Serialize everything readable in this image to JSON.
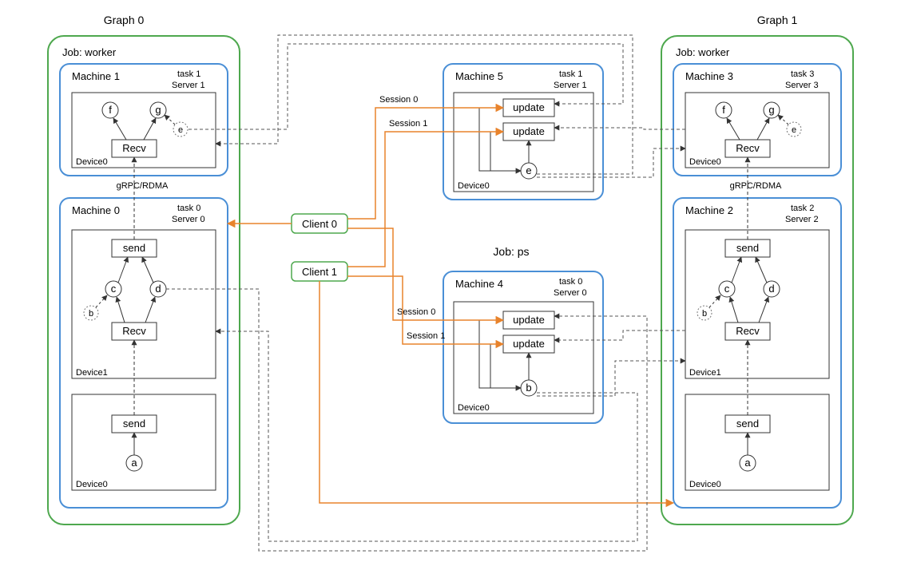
{
  "graphs": {
    "left": {
      "title": "Graph 0"
    },
    "right": {
      "title": "Graph 1"
    }
  },
  "job_worker_label": "Job: worker",
  "job_ps_label": "Job: ps",
  "left_graph": {
    "machine1": {
      "title": "Machine 1",
      "task": "task 1",
      "server": "Server 1",
      "device": "Device0",
      "recv": "Recv",
      "f": "f",
      "g": "g",
      "e": "e"
    },
    "transport": "gRPC/RDMA",
    "machine0": {
      "title": "Machine 0",
      "task": "task 0",
      "server": "Server 0",
      "device1_label": "Device1",
      "device0_label": "Device0",
      "send": "send",
      "recv": "Recv",
      "a": "a",
      "b": "b",
      "c": "c",
      "d": "d"
    }
  },
  "right_graph": {
    "machine3": {
      "title": "Machine 3",
      "task": "task 3",
      "server": "Server 3",
      "device": "Device0",
      "recv": "Recv",
      "f": "f",
      "g": "g",
      "e": "e"
    },
    "transport": "gRPC/RDMA",
    "machine2": {
      "title": "Machine 2",
      "task": "task 2",
      "server": "Server 2",
      "device1_label": "Device1",
      "device0_label": "Device0",
      "send": "send",
      "recv": "Recv",
      "a": "a",
      "b": "b",
      "c": "c",
      "d": "d"
    }
  },
  "clients": {
    "c0": "Client 0",
    "c1": "Client 1"
  },
  "sessions": {
    "s0": "Session 0",
    "s1": "Session 1"
  },
  "ps": {
    "machine5": {
      "title": "Machine 5",
      "task": "task 1",
      "server": "Server 1",
      "device": "Device0",
      "update": "update",
      "e": "e"
    },
    "machine4": {
      "title": "Machine 4",
      "task": "task 0",
      "server": "Server 0",
      "device": "Device0",
      "update": "update",
      "b": "b"
    }
  }
}
